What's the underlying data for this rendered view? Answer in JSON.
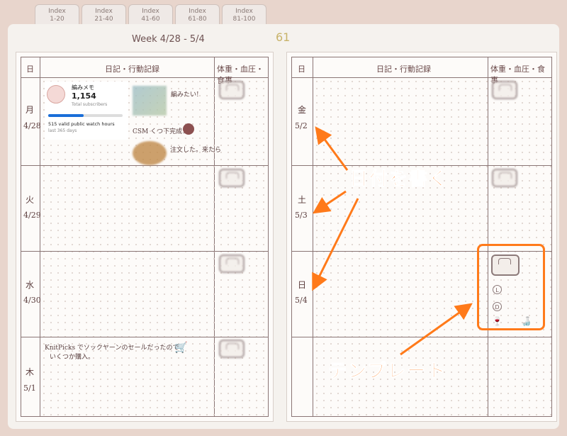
{
  "tabs": [
    {
      "line1": "Index",
      "line2": "1-20"
    },
    {
      "line1": "Index",
      "line2": "21-40"
    },
    {
      "line1": "Index",
      "line2": "41-60"
    },
    {
      "line1": "Index",
      "line2": "61-80"
    },
    {
      "line1": "Index",
      "line2": "81-100"
    }
  ],
  "header": {
    "week": "Week 4/28 - 5/4",
    "page_number": "61"
  },
  "columns": {
    "day": "日",
    "diary": "日記・行動記録",
    "health": "体重・血圧・食事"
  },
  "left_rows": [
    {
      "day": "月",
      "date": "4/28"
    },
    {
      "day": "火",
      "date": "4/29"
    },
    {
      "day": "水",
      "date": "4/30"
    },
    {
      "day": "木",
      "date": "5/1"
    }
  ],
  "right_rows": [
    {
      "day": "金",
      "date": "5/2"
    },
    {
      "day": "土",
      "date": "5/3"
    },
    {
      "day": "日",
      "date": "5/4"
    }
  ],
  "widget": {
    "title": "編みメモ",
    "count": "1,154",
    "count_label": "Total subscribers",
    "progress": 0.48,
    "hours": "515 valid public watch hours",
    "period": "last 365 days"
  },
  "diary_notes": {
    "note1": "編みたい!",
    "note2": "CSM くつ下完成！",
    "note3": "注文した。来たら",
    "thursday": "KnitPicks でソックヤーンのセールだったので",
    "thursday2": "いくつか購入。"
  },
  "template_labels": {
    "lunch": "L",
    "dinner": "D"
  },
  "annotations": {
    "date_callout": "日付を書く",
    "template_callout": "テンプレート"
  },
  "colors": {
    "accent": "#ff7a1a",
    "bar": "#1a6ed8"
  }
}
